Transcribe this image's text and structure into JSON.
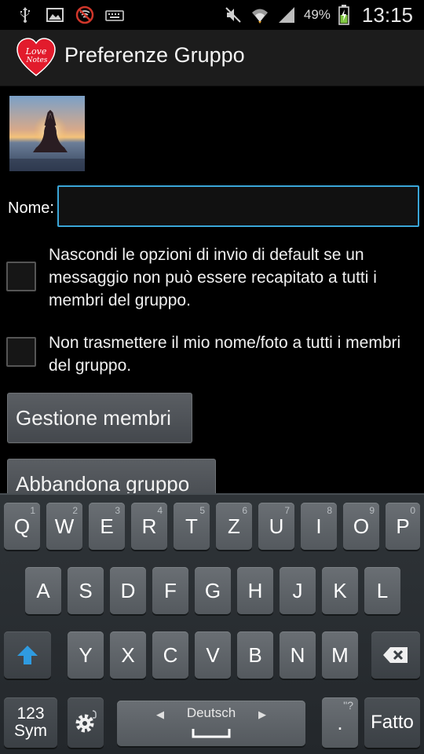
{
  "status_bar": {
    "left_icons": [
      "usb-icon",
      "image-icon",
      "no-signal-icon",
      "keyboard-icon"
    ],
    "right_icons": [
      "mute-icon",
      "wifi-icon",
      "cellular-signal-icon",
      "battery-charging-icon"
    ],
    "battery_percent": "49%",
    "time": "13:15"
  },
  "action_bar": {
    "title": "Preferenze Gruppo",
    "logo_text_line1": "Love",
    "logo_text_line2": "Notes"
  },
  "form": {
    "name_label": "Nome:",
    "name_value": "",
    "option1_text": "Nascondi le opzioni di invio di default se un messaggio non può essere recapitato a tutti i membri del gruppo.",
    "option1_checked": false,
    "option2_text": "Non trasmettere il mio nome/foto a tutti i membri del gruppo.",
    "option2_checked": false,
    "manage_members_label": "Gestione membri",
    "leave_group_label": "Abbandona gruppo"
  },
  "keyboard": {
    "row1": [
      {
        "key": "Q",
        "num": "1"
      },
      {
        "key": "W",
        "num": "2"
      },
      {
        "key": "E",
        "num": "3"
      },
      {
        "key": "R",
        "num": "4"
      },
      {
        "key": "T",
        "num": "5"
      },
      {
        "key": "Z",
        "num": "6"
      },
      {
        "key": "U",
        "num": "7"
      },
      {
        "key": "I",
        "num": "8"
      },
      {
        "key": "O",
        "num": "9"
      },
      {
        "key": "P",
        "num": "0"
      }
    ],
    "row2": [
      "A",
      "S",
      "D",
      "F",
      "G",
      "H",
      "J",
      "K",
      "L"
    ],
    "row3": [
      "Y",
      "X",
      "C",
      "V",
      "B",
      "N",
      "M"
    ],
    "sym_line1": "123",
    "sym_line2": "Sym",
    "space_label": "Deutsch",
    "period_key": ".",
    "period_sub": "\"?",
    "done_label": "Fatto",
    "accent_color": "#2f9be0"
  }
}
